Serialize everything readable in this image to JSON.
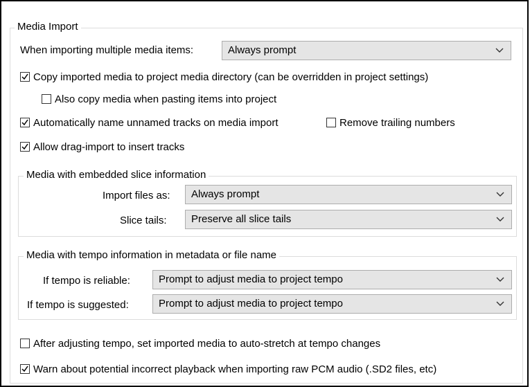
{
  "media_import": {
    "title": "Media Import",
    "multiple_items_label": "When importing multiple media items:",
    "multiple_items_value": "Always prompt",
    "copy_to_project": {
      "label": "Copy imported media to project media directory (can be overridden in project settings)",
      "checked": true
    },
    "copy_when_pasting": {
      "label": "Also copy media when pasting items into project",
      "checked": false
    },
    "auto_name_tracks": {
      "label": "Automatically name unnamed tracks on media import",
      "checked": true
    },
    "remove_trailing": {
      "label": "Remove trailing numbers",
      "checked": false
    },
    "drag_import": {
      "label": "Allow drag-import to insert tracks",
      "checked": true
    },
    "slice": {
      "title": "Media with embedded slice information",
      "import_files_label": "Import files as:",
      "import_files_value": "Always prompt",
      "slice_tails_label": "Slice tails:",
      "slice_tails_value": "Preserve all slice tails"
    },
    "tempo": {
      "title": "Media with tempo information in metadata or file name",
      "reliable_label": "If tempo is reliable:",
      "reliable_value": "Prompt to adjust media to project tempo",
      "suggested_label": "If tempo is suggested:",
      "suggested_value": "Prompt to adjust media to project tempo"
    },
    "auto_stretch": {
      "label": "After adjusting tempo, set imported media to auto-stretch at tempo changes",
      "checked": false
    },
    "warn_pcm": {
      "label": "Warn about potential incorrect playback when importing raw PCM audio (.SD2 files, etc)",
      "checked": true
    }
  },
  "icons": {
    "checkmark": "check-icon",
    "dropdown": "chevron-down-icon"
  }
}
